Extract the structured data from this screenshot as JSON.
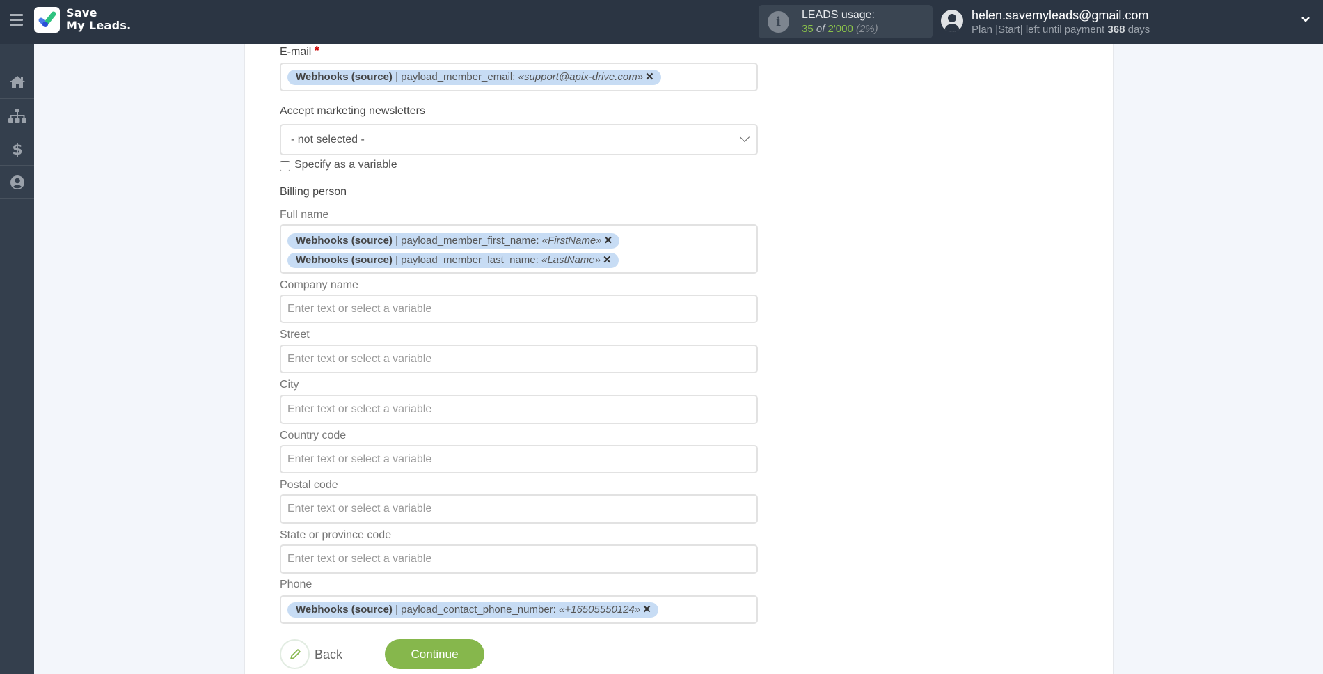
{
  "header": {
    "logo_line1": "Save",
    "logo_line2": "My Leads.",
    "leads_usage_title": "LEADS usage:",
    "leads_used": "35",
    "leads_of": "of",
    "leads_total": "2'000",
    "leads_percent": "(2%)",
    "user_email": "helen.savemyleads@gmail.com",
    "plan_text": "Plan |Start| left until payment",
    "plan_days": "368",
    "plan_days_suffix": "days"
  },
  "sidebar": {
    "items": [
      {
        "name": "home",
        "icon": "home-icon"
      },
      {
        "name": "connections",
        "icon": "sitemap-icon"
      },
      {
        "name": "billing",
        "icon": "dollar-icon"
      },
      {
        "name": "account",
        "icon": "user-circle-icon"
      }
    ]
  },
  "form": {
    "email": {
      "label": "E-mail",
      "required_mark": "*",
      "tags": [
        {
          "source": "Webhooks (source)",
          "field": " | payload_member_email: ",
          "value": "«support@apix-drive.com»",
          "remove": "✕"
        }
      ]
    },
    "newsletters": {
      "label": "Accept marketing newsletters",
      "selected": "- not selected -",
      "specify_variable_label": "Specify as a variable",
      "specify_variable_checked": false
    },
    "billing_section": "Billing person",
    "full_name": {
      "label": "Full name",
      "tags": [
        {
          "source": "Webhooks (source)",
          "field": " | payload_member_first_name: ",
          "value": "«FirstName»",
          "remove": "✕"
        },
        {
          "source": "Webhooks (source)",
          "field": " | payload_member_last_name: ",
          "value": "«LastName»",
          "remove": "✕"
        }
      ]
    },
    "company_name": {
      "label": "Company name",
      "placeholder": "Enter text or select a variable",
      "value": ""
    },
    "street": {
      "label": "Street",
      "placeholder": "Enter text or select a variable",
      "value": ""
    },
    "city": {
      "label": "City",
      "placeholder": "Enter text or select a variable",
      "value": ""
    },
    "country_code": {
      "label": "Country code",
      "placeholder": "Enter text or select a variable",
      "value": ""
    },
    "postal_code": {
      "label": "Postal code",
      "placeholder": "Enter text or select a variable",
      "value": ""
    },
    "state_code": {
      "label": "State or province code",
      "placeholder": "Enter text or select a variable",
      "value": ""
    },
    "phone": {
      "label": "Phone",
      "tags": [
        {
          "source": "Webhooks (source)",
          "field": " | payload_contact_phone_number: ",
          "value": "«+16505550124»",
          "remove": "✕"
        }
      ]
    }
  },
  "actions": {
    "back_label": "Back",
    "continue_label": "Continue"
  },
  "colors": {
    "header_bg": "#2b3543",
    "sidebar_bg": "#343f4d",
    "accent_green": "#86b74c",
    "tag_bg": "#c7dcf4",
    "leads_green": "#8bc34a"
  }
}
